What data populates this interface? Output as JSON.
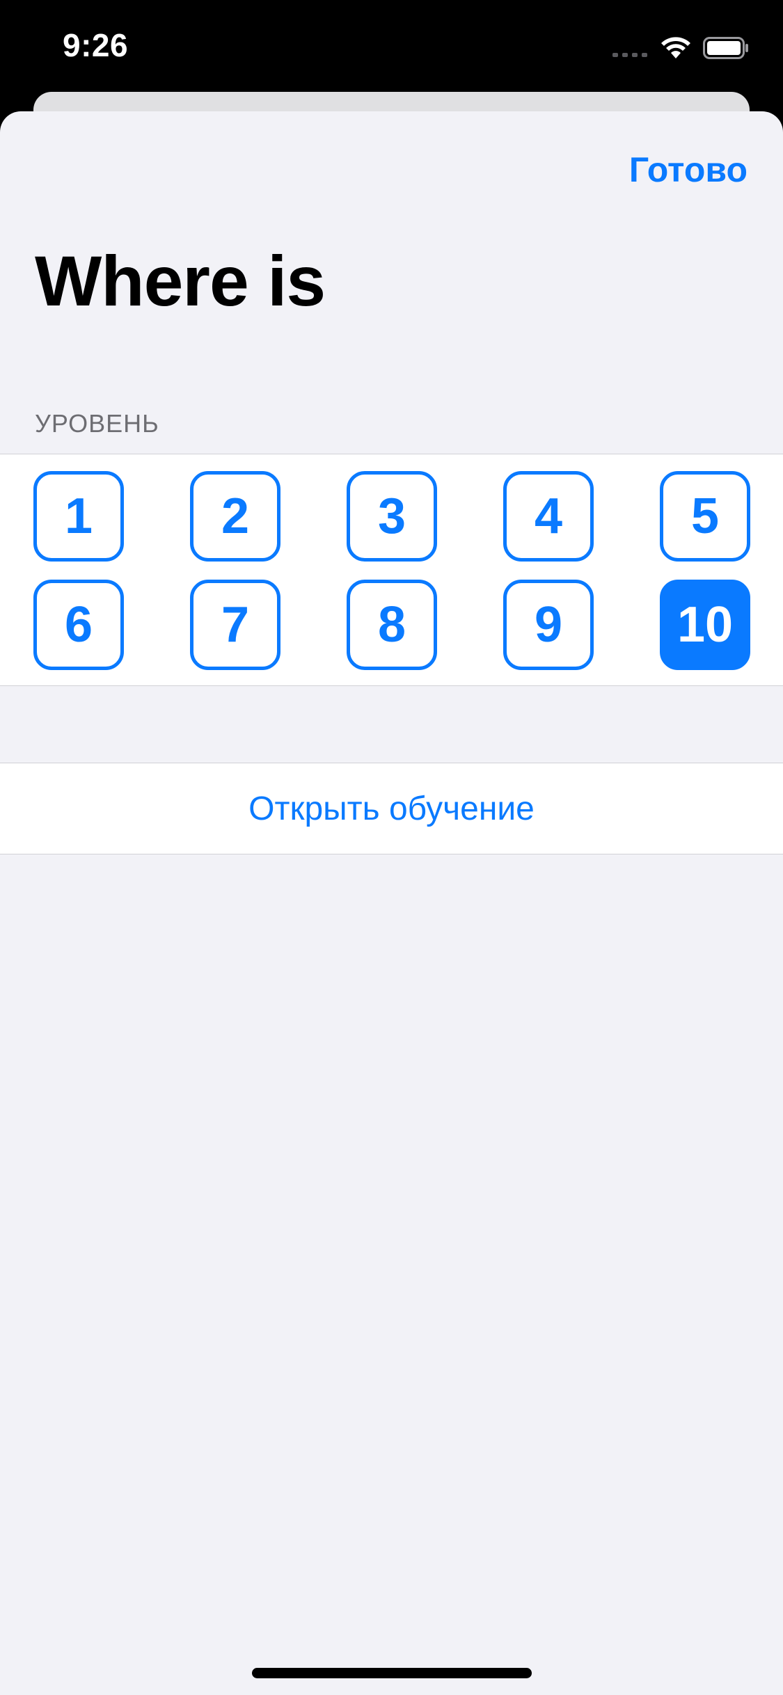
{
  "status_bar": {
    "time": "9:26",
    "signal_icon": "cellular-signal-icon",
    "wifi_icon": "wifi-icon",
    "battery_icon": "battery-icon"
  },
  "nav": {
    "done_label": "Готово"
  },
  "title": "Where is",
  "level_section": {
    "header": "УРОВЕНЬ",
    "levels": [
      "1",
      "2",
      "3",
      "4",
      "5",
      "6",
      "7",
      "8",
      "9",
      "10"
    ],
    "selected": "10"
  },
  "tutorial": {
    "label": "Открыть обучение"
  },
  "colors": {
    "accent": "#0a7aff",
    "background": "#f2f2f7",
    "card": "#ffffff",
    "secondary_text": "#6d6d72"
  }
}
